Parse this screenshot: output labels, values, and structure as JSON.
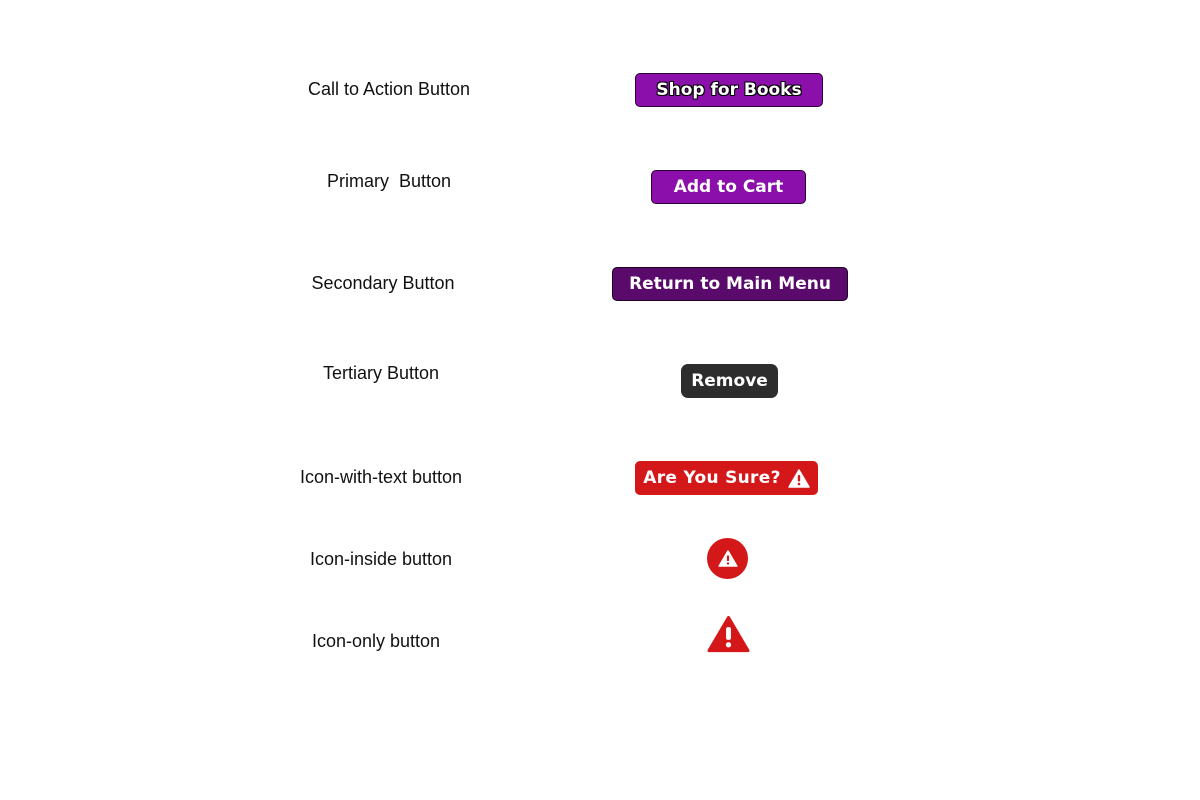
{
  "rows": [
    {
      "label": "Call to Action Button",
      "button_text": "Shop for Books"
    },
    {
      "label": "Primary  Button",
      "button_text": "Add to Cart"
    },
    {
      "label": "Secondary Button",
      "button_text": "Return to Main Menu"
    },
    {
      "label": "Tertiary Button",
      "button_text": "Remove"
    },
    {
      "label": "Icon-with-text button",
      "button_text": "Are You Sure?",
      "icon": "warning-triangle-icon"
    },
    {
      "label": "Icon-inside button",
      "icon": "warning-triangle-icon"
    },
    {
      "label": "Icon-only button",
      "icon": "warning-triangle-icon"
    }
  ],
  "colors": {
    "purple": "#8b0faa",
    "dark_purple": "#5a0a6a",
    "dark_gray": "#2d2d2d",
    "red": "#d41719"
  }
}
